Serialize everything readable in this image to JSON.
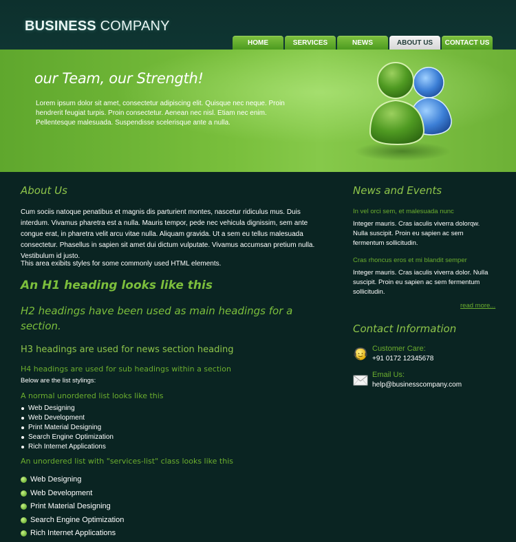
{
  "header": {
    "logo_bold": "BUSINESS",
    "logo_rest": "COMPANY",
    "nav": [
      {
        "label": "HOME"
      },
      {
        "label": "SERVICES"
      },
      {
        "label": "NEWS"
      },
      {
        "label": "ABOUT US",
        "active": true
      },
      {
        "label": "CONTACT US"
      }
    ]
  },
  "banner": {
    "title": "our Team, our Strength!",
    "text": "Lorem ipsum dolor sit amet, consectetur adipiscing elit. Quisque nec neque. Proin hendrerit feugiat turpis. Proin consectetur. Aenean nec nisl. Etiam nec enim. Pellentesque malesuada. Suspendisse scelerisque ante a nulla."
  },
  "about": {
    "title": "About Us",
    "paragraph": "Cum sociis natoque penatibus et magnis dis parturient montes, nascetur ridiculus mus. Duis interdum. Vivamus pharetra est a nulla. Mauris tempor, pede nec vehicula dignissim, sem ante congue erat, in pharetra velit arcu vitae nulla. Aliquam gravida. Ut a sem eu tellus malesuada consectetur. Phasellus in sapien sit amet dui dictum vulputate. Vivamus accumsan pretium nulla. Vestibulum id justo.",
    "area_note": "This area exibits styles for some commonly used HTML elements.",
    "h1": "An H1 heading looks like this",
    "h2": "H2 headings have been used as main headings for a section.",
    "h3": "H3 headings are used for news section heading",
    "h4": "H4 headings are used for sub headings within a section",
    "list_note": "Below are the list stylings:",
    "ul_title": "A normal unordered list looks like this",
    "ul_items": [
      "Web Designing",
      "Web Development",
      "Print Material Designing",
      "Search Engine Optimization",
      "Rich Internet Applications"
    ],
    "services_title": "An unordered list with \"services-list\" class looks like this",
    "services_items": [
      "Web Designing",
      "Web Development",
      "Print Material Designing",
      "Search Engine Optimization",
      "Rich Internet Applications"
    ]
  },
  "news": {
    "title": "News and Events",
    "items": [
      {
        "title": "In vel orci sem, et malesuada nunc",
        "body": "Integer mauris. Cras iaculis viverra dolorqw. Nulla suscipit. Proin eu sapien ac sem fermentum sollicitudin."
      },
      {
        "title": "Cras rhoncus eros et mi blandit semper",
        "body": "Integer mauris. Cras iaculis viverra dolor. Nulla suscipit. Proin eu sapien ac sem fermentum sollicitudin."
      }
    ],
    "read_more": "read more..."
  },
  "contact": {
    "title": "Contact Information",
    "care_label": "Customer Care:",
    "care_value": "+91 0172 12345678",
    "email_label": "Email Us:",
    "email_value": "help@businesscompany.com"
  },
  "colors": {
    "background": "#0a2422",
    "accent_green": "#7cbf3c",
    "banner_green": "#79bf3c",
    "nav_active": "#e4e4e4"
  },
  "icons": [
    "team-users-icon",
    "headset-support-icon",
    "envelope-icon",
    "check-bullet-icon"
  ]
}
